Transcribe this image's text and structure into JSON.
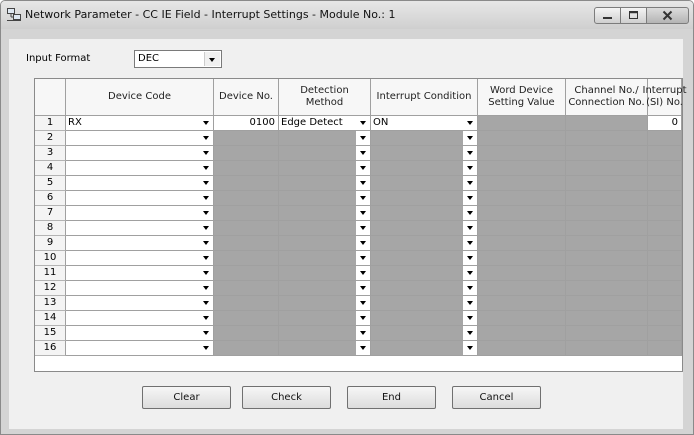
{
  "window": {
    "title": "Network Parameter - CC IE Field - Interrupt Settings - Module No.: 1"
  },
  "input_format": {
    "label": "Input Format",
    "value": "DEC"
  },
  "grid": {
    "headers": [
      "Device Code",
      "Device No.",
      "Detection Method",
      "Interrupt Condition",
      "Word Device Setting Value",
      "Channel No./ Connection No.",
      "Interrupt (SI) No."
    ],
    "rows": [
      {
        "num": "1",
        "device_code": "RX",
        "device_no": "0100",
        "detection_method": "Edge Detect",
        "interrupt_condition": "ON",
        "word_device_setting_value": "",
        "channel_no": "",
        "interrupt_si_no": "0"
      },
      {
        "num": "2",
        "device_code": "",
        "device_no": "",
        "detection_method": "",
        "interrupt_condition": "",
        "word_device_setting_value": "",
        "channel_no": "",
        "interrupt_si_no": ""
      },
      {
        "num": "3",
        "device_code": "",
        "device_no": "",
        "detection_method": "",
        "interrupt_condition": "",
        "word_device_setting_value": "",
        "channel_no": "",
        "interrupt_si_no": ""
      },
      {
        "num": "4",
        "device_code": "",
        "device_no": "",
        "detection_method": "",
        "interrupt_condition": "",
        "word_device_setting_value": "",
        "channel_no": "",
        "interrupt_si_no": ""
      },
      {
        "num": "5",
        "device_code": "",
        "device_no": "",
        "detection_method": "",
        "interrupt_condition": "",
        "word_device_setting_value": "",
        "channel_no": "",
        "interrupt_si_no": ""
      },
      {
        "num": "6",
        "device_code": "",
        "device_no": "",
        "detection_method": "",
        "interrupt_condition": "",
        "word_device_setting_value": "",
        "channel_no": "",
        "interrupt_si_no": ""
      },
      {
        "num": "7",
        "device_code": "",
        "device_no": "",
        "detection_method": "",
        "interrupt_condition": "",
        "word_device_setting_value": "",
        "channel_no": "",
        "interrupt_si_no": ""
      },
      {
        "num": "8",
        "device_code": "",
        "device_no": "",
        "detection_method": "",
        "interrupt_condition": "",
        "word_device_setting_value": "",
        "channel_no": "",
        "interrupt_si_no": ""
      },
      {
        "num": "9",
        "device_code": "",
        "device_no": "",
        "detection_method": "",
        "interrupt_condition": "",
        "word_device_setting_value": "",
        "channel_no": "",
        "interrupt_si_no": ""
      },
      {
        "num": "10",
        "device_code": "",
        "device_no": "",
        "detection_method": "",
        "interrupt_condition": "",
        "word_device_setting_value": "",
        "channel_no": "",
        "interrupt_si_no": ""
      },
      {
        "num": "11",
        "device_code": "",
        "device_no": "",
        "detection_method": "",
        "interrupt_condition": "",
        "word_device_setting_value": "",
        "channel_no": "",
        "interrupt_si_no": ""
      },
      {
        "num": "12",
        "device_code": "",
        "device_no": "",
        "detection_method": "",
        "interrupt_condition": "",
        "word_device_setting_value": "",
        "channel_no": "",
        "interrupt_si_no": ""
      },
      {
        "num": "13",
        "device_code": "",
        "device_no": "",
        "detection_method": "",
        "interrupt_condition": "",
        "word_device_setting_value": "",
        "channel_no": "",
        "interrupt_si_no": ""
      },
      {
        "num": "14",
        "device_code": "",
        "device_no": "",
        "detection_method": "",
        "interrupt_condition": "",
        "word_device_setting_value": "",
        "channel_no": "",
        "interrupt_si_no": ""
      },
      {
        "num": "15",
        "device_code": "",
        "device_no": "",
        "detection_method": "",
        "interrupt_condition": "",
        "word_device_setting_value": "",
        "channel_no": "",
        "interrupt_si_no": ""
      },
      {
        "num": "16",
        "device_code": "",
        "device_no": "",
        "detection_method": "",
        "interrupt_condition": "",
        "word_device_setting_value": "",
        "channel_no": "",
        "interrupt_si_no": ""
      }
    ]
  },
  "buttons": {
    "clear": "Clear",
    "check": "Check",
    "end": "End",
    "cancel": "Cancel"
  },
  "icons": {
    "window": "network-window-icon",
    "minimize": "minimize-icon",
    "maximize": "maximize-icon",
    "close": "close-icon",
    "dropdown": "chevron-down-icon"
  },
  "colors": {
    "disabled_cell": "#a6a6a6",
    "editable_cell": "#ffffff",
    "dialog_background": "#f0f0f0"
  }
}
